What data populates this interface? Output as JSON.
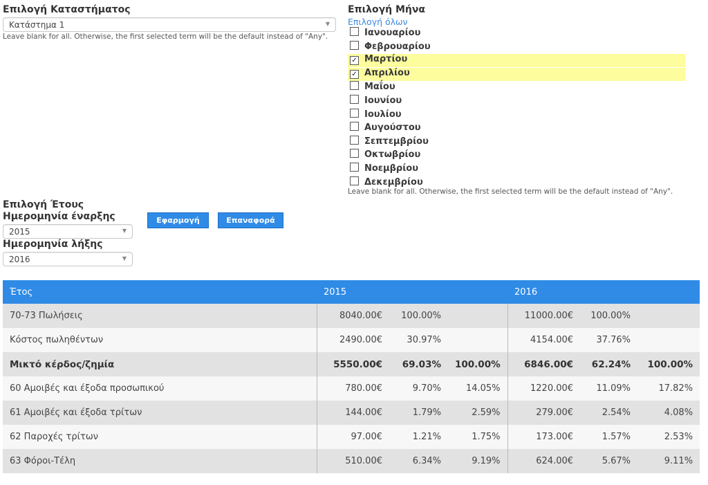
{
  "store": {
    "label": "Επιλογή Καταστήματος",
    "selected": "Κατάστημα 1",
    "hint": "Leave blank for all. Otherwise, the first selected term will be the default instead of \"Any\"."
  },
  "month": {
    "label": "Επιλογή Μήνα",
    "select_all": "Επιλογή όλων",
    "hint": "Leave blank for all. Otherwise, the first selected term will be the default instead of \"Any\".",
    "items": [
      {
        "label": "Ιανουαρίου",
        "checked": false
      },
      {
        "label": "Φεβρουαρίου",
        "checked": false
      },
      {
        "label": "Μαρτίου",
        "checked": true
      },
      {
        "label": "Απριλίου",
        "checked": true
      },
      {
        "label": "Μαΐου",
        "checked": false
      },
      {
        "label": "Ιουνίου",
        "checked": false
      },
      {
        "label": "Ιουλίου",
        "checked": false
      },
      {
        "label": "Αυγούστου",
        "checked": false
      },
      {
        "label": "Σεπτεμβρίου",
        "checked": false
      },
      {
        "label": "Οκτωβρίου",
        "checked": false
      },
      {
        "label": "Νοεμβρίου",
        "checked": false
      },
      {
        "label": "Δεκεμβρίου",
        "checked": false
      }
    ]
  },
  "year": {
    "label": "Επιλογή Έτους",
    "start_label": "Ημερομηνία έναρξης",
    "start_value": "2015",
    "end_label": "Ημερομηνία λήξης",
    "end_value": "2016"
  },
  "buttons": {
    "apply": "Εφαρμογή",
    "reset": "Επαναφορά"
  },
  "table": {
    "headers": [
      "Έτος",
      "2015",
      "2016"
    ],
    "rows": [
      {
        "label": "70-73 Πωλήσεις",
        "y1": [
          "8040.00€",
          "100.00%",
          ""
        ],
        "y2": [
          "11000.00€",
          "100.00%",
          ""
        ],
        "bold": false
      },
      {
        "label": "Κόστος πωληθέντων",
        "y1": [
          "2490.00€",
          "30.97%",
          ""
        ],
        "y2": [
          "4154.00€",
          "37.76%",
          ""
        ],
        "bold": false
      },
      {
        "label": "Μικτό κέρδος/ζημία",
        "y1": [
          "5550.00€",
          "69.03%",
          "100.00%"
        ],
        "y2": [
          "6846.00€",
          "62.24%",
          "100.00%"
        ],
        "bold": true
      },
      {
        "label": "60 Αμοιβές και έξοδα προσωπικού",
        "y1": [
          "780.00€",
          "9.70%",
          "14.05%"
        ],
        "y2": [
          "1220.00€",
          "11.09%",
          "17.82%"
        ],
        "bold": false
      },
      {
        "label": "61 Αμοιβές και έξοδα τρίτων",
        "y1": [
          "144.00€",
          "1.79%",
          "2.59%"
        ],
        "y2": [
          "279.00€",
          "2.54%",
          "4.08%"
        ],
        "bold": false
      },
      {
        "label": "62 Παροχές τρίτων",
        "y1": [
          "97.00€",
          "1.21%",
          "1.75%"
        ],
        "y2": [
          "173.00€",
          "1.57%",
          "2.53%"
        ],
        "bold": false
      },
      {
        "label": "63 Φόροι-Τέλη",
        "y1": [
          "510.00€",
          "6.34%",
          "9.19%"
        ],
        "y2": [
          "624.00€",
          "5.67%",
          "9.11%"
        ],
        "bold": false
      }
    ]
  }
}
